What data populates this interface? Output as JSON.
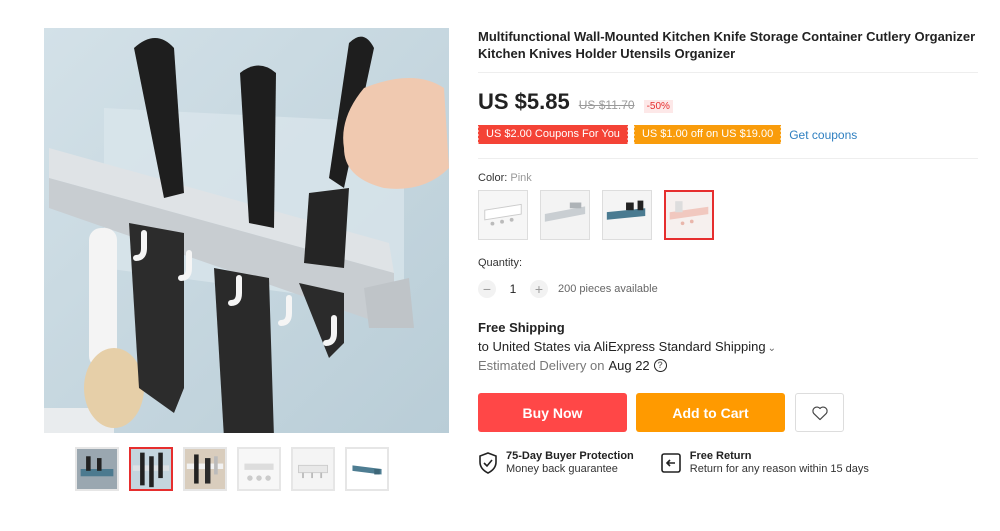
{
  "product": {
    "title": "Multifunctional Wall-Mounted Kitchen Knife Storage Container Cutlery Organizer Kitchen Knives Holder Utensils Organizer",
    "price": "US $5.85",
    "original_price": "US $11.70",
    "discount": "-50%"
  },
  "coupons": {
    "first": "US $2.00 Coupons For You",
    "second": "US $1.00 off on US $19.00",
    "get_label": "Get coupons"
  },
  "color": {
    "label": "Color:",
    "selected": "Pink",
    "options": [
      "White",
      "Gray",
      "Blue",
      "Pink"
    ]
  },
  "quantity": {
    "label": "Quantity:",
    "minus": "−",
    "value": "1",
    "plus": "+",
    "available": "200 pieces available"
  },
  "shipping": {
    "title": "Free Shipping",
    "destination": "to United States via AliExpress Standard Shipping",
    "chevron": "⌄",
    "estimate_label": "Estimated Delivery on",
    "estimate_date": "Aug 22",
    "help_glyph": "?"
  },
  "actions": {
    "buy_now": "Buy Now",
    "add_to_cart": "Add to Cart"
  },
  "guarantees": [
    {
      "title": "75-Day Buyer Protection",
      "subtitle": "Money back guarantee",
      "icon": "shield-check-icon"
    },
    {
      "title": "Free Return",
      "subtitle": "Return for any reason within 15 days",
      "icon": "return-icon"
    }
  ],
  "gallery": {
    "thumbnail_count": 6,
    "active_index": 1
  },
  "colors": {
    "price_red": "#e62e2e",
    "buy_button": "#ff4747",
    "cart_button": "#ff9a00",
    "coupon_red": "#f44336",
    "coupon_orange": "#f99c0b",
    "link_blue": "#2e7fc0"
  }
}
